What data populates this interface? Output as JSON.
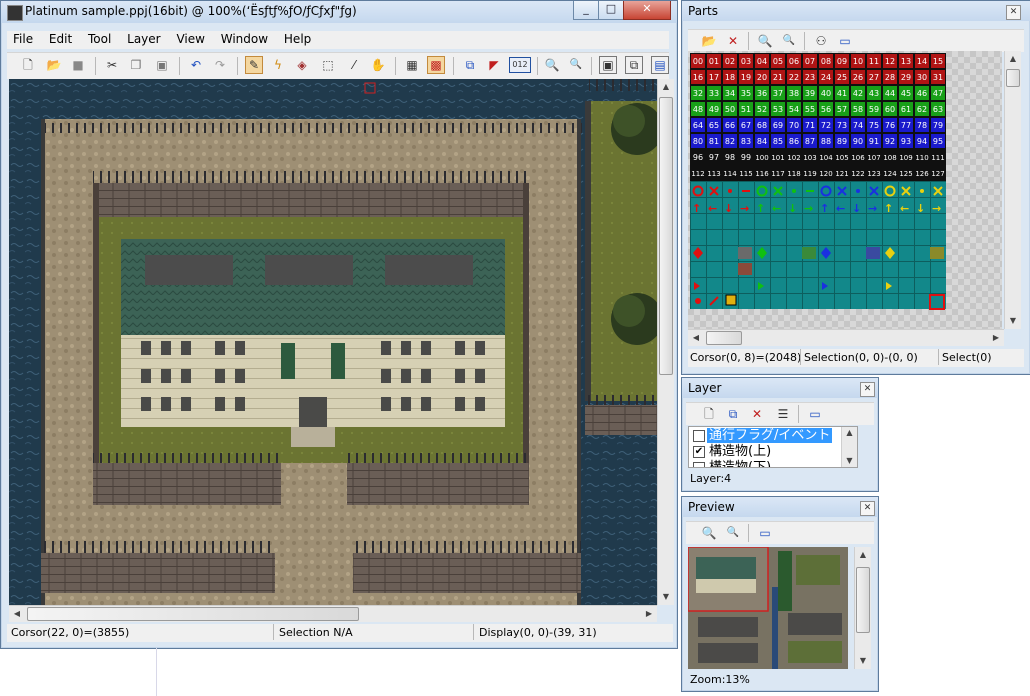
{
  "main": {
    "title": "Platinum sample.ppj(16bit)  @ 100%(‘Ësƒtƒ%ƒO/ƒCƒxƒ\"ƒg)",
    "menu": [
      "File",
      "Edit",
      "Tool",
      "Layer",
      "View",
      "Window",
      "Help"
    ],
    "toolbar_icons": [
      "new-icon",
      "open-icon",
      "save-icon",
      "cut-icon",
      "copy-icon",
      "paste-icon",
      "undo-icon",
      "redo-icon",
      "pen-icon",
      "eyedrop-icon",
      "fill-icon",
      "select-icon",
      "picker-icon",
      "hand-icon",
      "grid-icon",
      "flag-icon",
      "layer-icon",
      "marker-icon",
      "number-icon",
      "zoom-in-icon",
      "zoom-out-icon",
      "view1-icon",
      "view2-icon",
      "view3-icon"
    ],
    "number_button": "012",
    "status_cursor": "Corsor(22, 0)=(3855)",
    "status_selection": "Selection N/A",
    "status_display": "Display(0, 0)-(39, 31)"
  },
  "parts": {
    "title": "Parts",
    "status_cursor": "Corsor(0, 8)=(2048)",
    "status_selection": "Selection(0, 0)-(0, 0)",
    "status_select": "Select(0)",
    "numbers": [
      "00",
      "01",
      "02",
      "03",
      "04",
      "05",
      "06",
      "07",
      "08",
      "09",
      "10",
      "11",
      "12",
      "13",
      "14",
      "15",
      "16",
      "17",
      "18",
      "19",
      "20",
      "21",
      "22",
      "23",
      "24",
      "25",
      "26",
      "27",
      "28",
      "29",
      "30",
      "31",
      "32",
      "33",
      "34",
      "35",
      "36",
      "37",
      "38",
      "39",
      "40",
      "41",
      "42",
      "43",
      "44",
      "45",
      "46",
      "47",
      "48",
      "49",
      "50",
      "51",
      "52",
      "53",
      "54",
      "55",
      "56",
      "57",
      "58",
      "59",
      "60",
      "61",
      "62",
      "63",
      "64",
      "65",
      "66",
      "67",
      "68",
      "69",
      "70",
      "71",
      "72",
      "73",
      "74",
      "75",
      "76",
      "77",
      "78",
      "79",
      "80",
      "81",
      "82",
      "83",
      "84",
      "85",
      "86",
      "87",
      "88",
      "89",
      "90",
      "91",
      "92",
      "93",
      "94",
      "95",
      "96",
      "97",
      "98",
      "99",
      "100",
      "101",
      "102",
      "103",
      "104",
      "105",
      "106",
      "107",
      "108",
      "109",
      "110",
      "111",
      "112",
      "113",
      "114",
      "115",
      "116",
      "117",
      "118",
      "119",
      "120",
      "121",
      "122",
      "123",
      "124",
      "125",
      "126",
      "127"
    ]
  },
  "layer": {
    "title": "Layer",
    "items": [
      {
        "label": "通行フラグ/イベント",
        "checked": false,
        "selected": true
      },
      {
        "label": "構造物(上)",
        "checked": true,
        "selected": false
      },
      {
        "label": "構造物(下)",
        "checked": false,
        "selected": false
      }
    ],
    "status": "Layer:4"
  },
  "preview": {
    "title": "Preview",
    "zoom": "Zoom:13%"
  },
  "colors": {
    "red_row": "#b01414",
    "green_row": "#18a018",
    "blue_row": "#1a1acc",
    "black_row": "#101010",
    "teal": "#0f8a8a"
  }
}
